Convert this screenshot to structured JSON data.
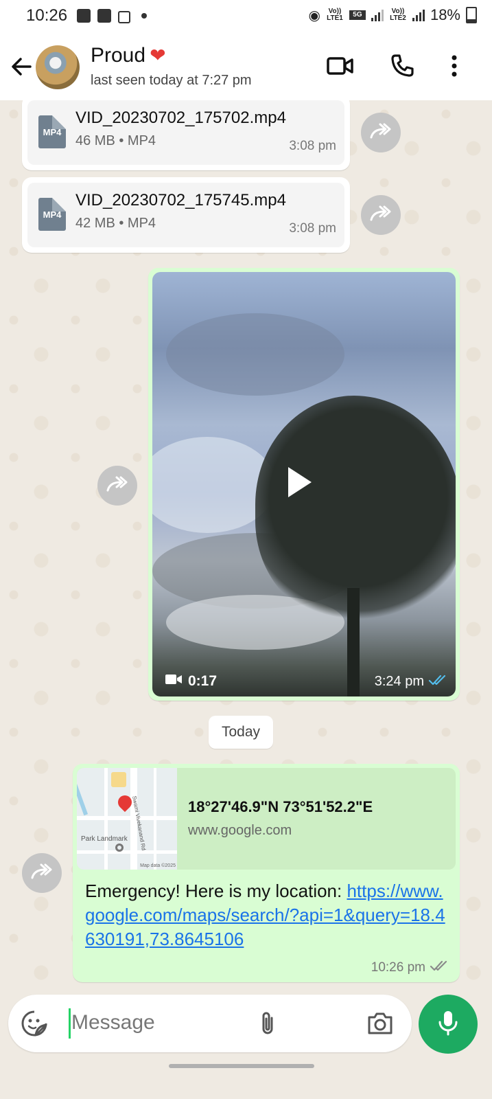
{
  "status_bar": {
    "time": "10:26",
    "volte1": "Vo)) LTE1",
    "network": "5G",
    "volte2": "Vo)) LTE2",
    "battery": "18%"
  },
  "header": {
    "contact_name": "Proud",
    "contact_emoji": "❤",
    "last_seen": "last seen today at 7:27 pm",
    "icons": [
      "back-arrow-icon",
      "video-call-icon",
      "voice-call-icon",
      "more-options-icon"
    ]
  },
  "messages": {
    "file1": {
      "badge": "MP4",
      "name": "VID_20230702_175702.mp4",
      "meta": "46 MB • MP4",
      "time": "3:08 pm"
    },
    "file2": {
      "badge": "MP4",
      "name": "VID_20230702_175745.mp4",
      "meta": "42 MB • MP4",
      "time": "3:08 pm"
    },
    "video": {
      "duration": "0:17",
      "time": "3:24 pm"
    },
    "date_divider": "Today",
    "location": {
      "map_label": "Park Landmark",
      "map_data": "Map data ©2025",
      "road_label": "Swami Vivekanand Rd",
      "coords": "18°27'46.9\"N 73°51'52.2\"E",
      "domain": "www.google.com",
      "text": "Emergency! Here is my location: ",
      "link": "https://www.google.com/maps/search/?api=1&query=18.4630191,73.8645106",
      "time": "10:26 pm"
    }
  },
  "input": {
    "placeholder": "Message"
  },
  "colors": {
    "outgoing_bubble": "#d9fdd3",
    "incoming_bubble": "#ffffff",
    "accent_green": "#1daa61",
    "link_blue": "#1a73e8",
    "read_tick_blue": "#53bdeb"
  }
}
